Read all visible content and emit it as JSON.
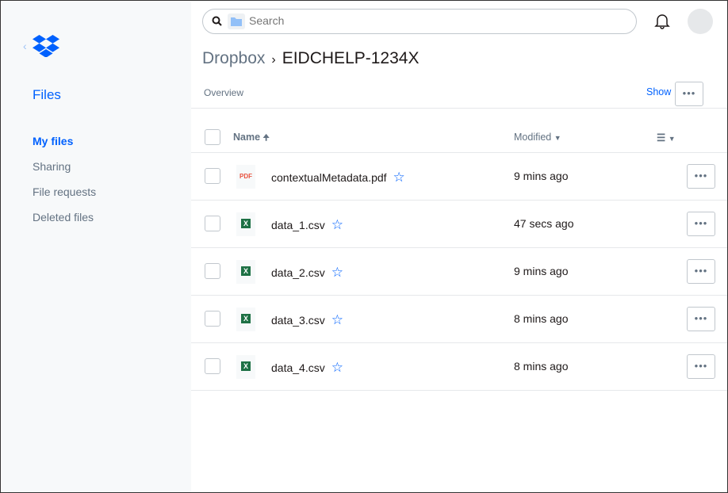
{
  "sidebar": {
    "title": "Files",
    "items": [
      {
        "label": "My files",
        "active": true
      },
      {
        "label": "Sharing"
      },
      {
        "label": "File requests"
      },
      {
        "label": "Deleted files"
      }
    ]
  },
  "search": {
    "placeholder": "Search"
  },
  "breadcrumb": {
    "root": "Dropbox",
    "current": "EIDCHELP-1234X"
  },
  "overview": {
    "label": "Overview",
    "show": "Show"
  },
  "table": {
    "headers": {
      "name": "Name",
      "modified": "Modified"
    },
    "rows": [
      {
        "name": "contextualMetadata.pdf",
        "type": "pdf",
        "icon_text": "PDF",
        "modified": "9 mins ago"
      },
      {
        "name": "data_1.csv",
        "type": "excel",
        "icon_text": "X",
        "modified": "47 secs ago"
      },
      {
        "name": "data_2.csv",
        "type": "excel",
        "icon_text": "X",
        "modified": "9 mins ago"
      },
      {
        "name": "data_3.csv",
        "type": "excel",
        "icon_text": "X",
        "modified": "8 mins ago"
      },
      {
        "name": "data_4.csv",
        "type": "excel",
        "icon_text": "X",
        "modified": "8 mins ago"
      }
    ]
  },
  "colors": {
    "accent": "#0061fe",
    "pdf": "#e8523f",
    "excel": "#1e7145"
  }
}
